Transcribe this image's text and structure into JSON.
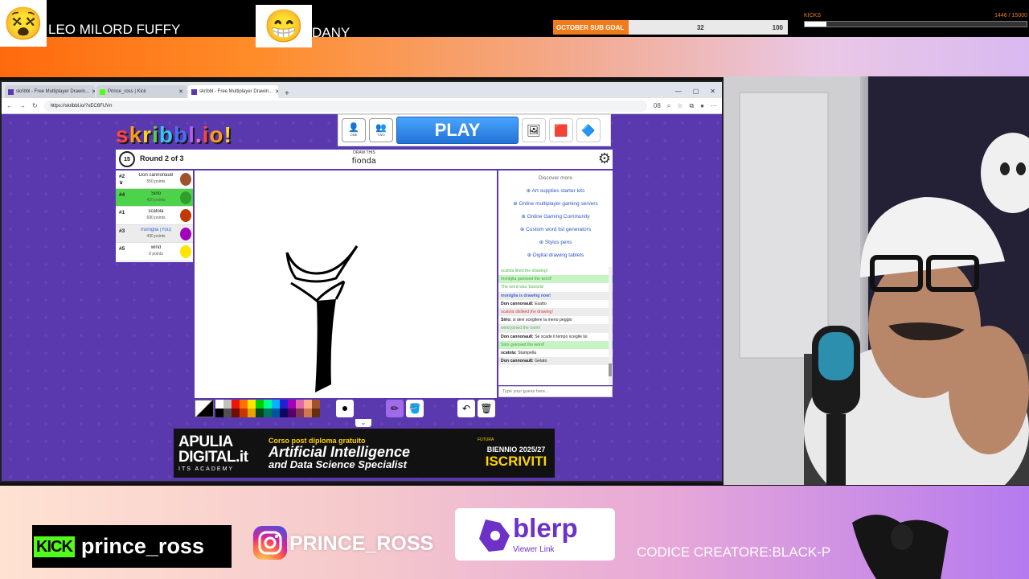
{
  "overlay": {
    "streamer1": "LEO MILORD FUFFY",
    "streamer2": "DANY",
    "sub_goal": {
      "label": "OCTOBER SUB GOAL",
      "current": "32",
      "target": "100"
    },
    "kicks": {
      "label": "KICKS",
      "value": "1446",
      "max": "/ 15000",
      "progress": 0.0964
    }
  },
  "browser": {
    "tabs": [
      {
        "label": "skribbl - Free Multiplayer Drawin...",
        "active": false
      },
      {
        "label": "Prince_ross | Kick",
        "active": false
      },
      {
        "label": "skribbl - Free Multiplayer Drawin...",
        "active": true
      }
    ],
    "url": "https://skribbl.io/?xEC6FUVn",
    "zoom": "08"
  },
  "game": {
    "logo": "skribbl.io",
    "mode_one": "ONE",
    "mode_two": "TWO",
    "play_label": "PLAY",
    "timer": "15",
    "round_text": "Round 2 of 3",
    "draw_this": "DRAW THIS",
    "word": "fionda",
    "players": [
      {
        "rank": "#2",
        "name": "Don cannonau8",
        "points": "550 points",
        "me": false
      },
      {
        "rank": "#4",
        "name": "Sirio",
        "points": "420 points",
        "me": false
      },
      {
        "rank": "#1",
        "name": "scatola",
        "points": "690 points",
        "me": false
      },
      {
        "rank": "#3",
        "name": "moniglia (You)",
        "points": "430 points",
        "me": true
      },
      {
        "rank": "#5",
        "name": "wind",
        "points": "0 points",
        "me": false
      }
    ],
    "discover_title": "Discover more",
    "discover_items": [
      "Art supplies starter kits",
      "Online multiplayer gaming servers",
      "Online Gaming Community",
      "Custom word list generators",
      "Stylus pens",
      "Digital drawing tablets"
    ],
    "chat": [
      {
        "author": "",
        "text": "scatola liked the drawing!"
      },
      {
        "author": "",
        "text": "moniglia guessed the word!"
      },
      {
        "author": "",
        "text": "The word was 'bussola'"
      },
      {
        "author": "",
        "text": "moniglia is drawing now!"
      },
      {
        "author": "Don cannonau8:",
        "text": "Esatto"
      },
      {
        "author": "",
        "text": "scatola disliked the drawing!"
      },
      {
        "author": "Sirio:",
        "text": "si devi scegliere la meno peggio"
      },
      {
        "author": "",
        "text": "wind joined the room!"
      },
      {
        "author": "Don cannonau8:",
        "text": "Se scade il tempo sceglie lui"
      },
      {
        "author": "",
        "text": "Sirio guessed the word!"
      },
      {
        "author": "scatola:",
        "text": "Stampella"
      },
      {
        "author": "Don cannonau8:",
        "text": "Gelato"
      }
    ],
    "chat_placeholder": "Type your guess here...",
    "palette": [
      "#ffffff",
      "#c1c1c1",
      "#ef130b",
      "#ff7100",
      "#ffe400",
      "#00cc00",
      "#00ff91",
      "#00b2ff",
      "#231fd3",
      "#a300ba",
      "#df69a7",
      "#ffac8e",
      "#a0522d",
      "#000000",
      "#505050",
      "#740b07",
      "#c23800",
      "#e8a200",
      "#004619",
      "#00785d",
      "#00569e",
      "#0e0865",
      "#550069",
      "#873554",
      "#cc774d",
      "#63300d"
    ]
  },
  "banner": {
    "brand": "APULIA DIGITAL.it",
    "sub": "ITS ACADEMY",
    "course": "Corso post diploma gratuito",
    "title1": "Artificial Intelligence",
    "title2": "and Data Science Specialist",
    "futura": "FUTURA",
    "biennio": "BIENNIO 2025/27",
    "cta": "ISCRIVITI"
  },
  "socials": {
    "kick_logo": "KICK",
    "kick_user": "prince_ross",
    "instagram_user": "PRINCE_ROSS",
    "blerp_name": "blerp",
    "blerp_sub": "Viewer Link",
    "creator_code": "CODICE CREATORE:BLACK-P"
  },
  "colors": {
    "skribbl_bg": "#5a38ae",
    "player_highlight": "#4cd34a",
    "play_button": "#2173d6",
    "kick_green": "#53fc18",
    "blerp_purple": "#6d31c8",
    "orange_accent": "#f07b1a"
  }
}
